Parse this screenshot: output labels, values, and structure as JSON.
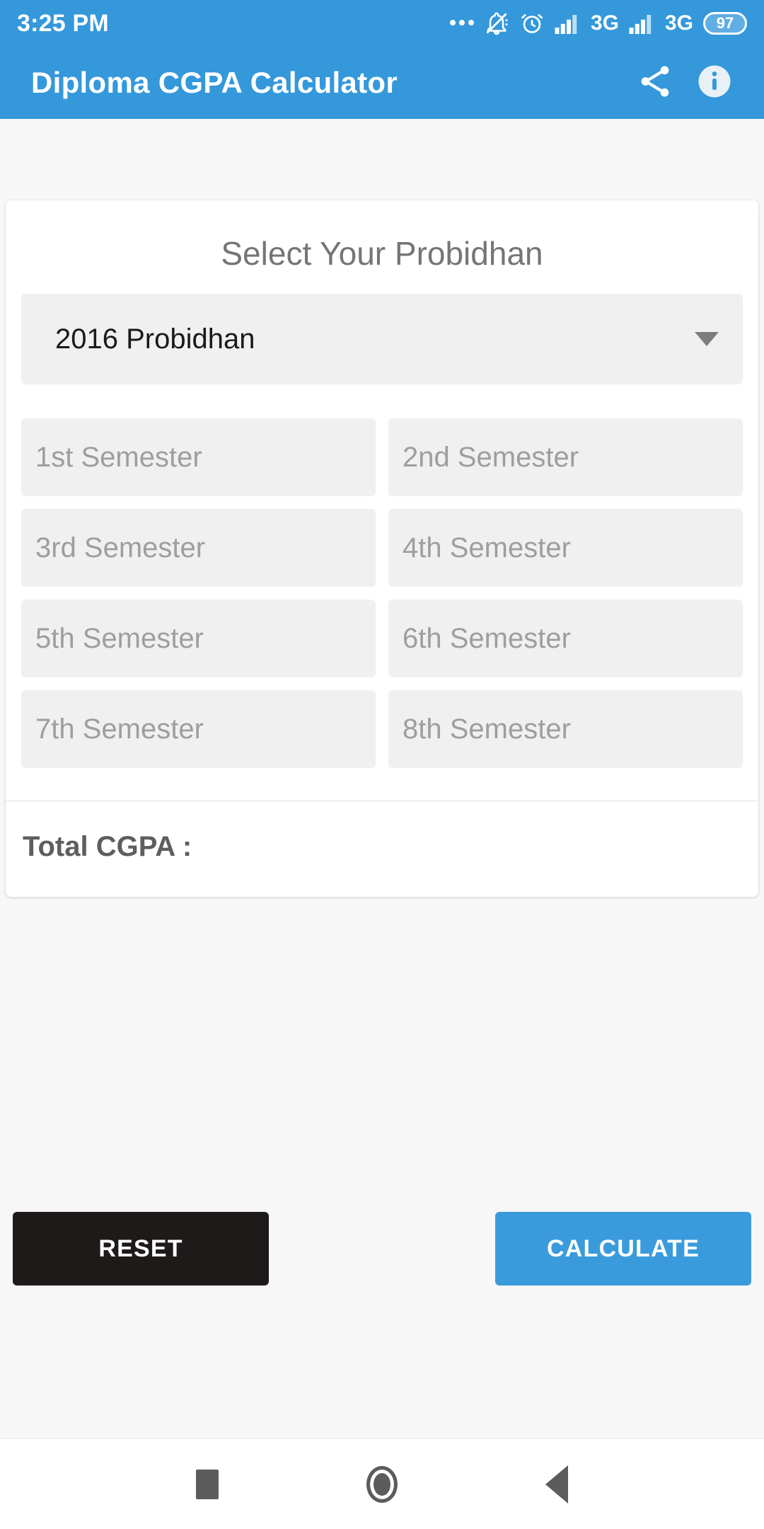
{
  "status_bar": {
    "time": "3:25 PM",
    "icons": [
      {
        "name": "more-notifications-icon",
        "label": "..."
      },
      {
        "name": "bell-muted-icon",
        "label": ""
      },
      {
        "name": "alarm-clock-icon",
        "label": ""
      },
      {
        "name": "signal-bars-icon",
        "label": ""
      },
      {
        "name": "network-type-1",
        "label": "3G"
      },
      {
        "name": "signal-bars-icon-2",
        "label": ""
      },
      {
        "name": "network-type-2",
        "label": "3G"
      }
    ],
    "battery_level": "97"
  },
  "app_bar": {
    "title": "Diploma CGPA Calculator",
    "share_icon": "share-icon",
    "info_icon": "info-icon"
  },
  "card": {
    "title": "Select Your Probidhan",
    "dropdown": {
      "selected": "2016 Probidhan",
      "caret_icon": "chevron-down-icon"
    },
    "semesters": [
      {
        "placeholder": "1st Semester",
        "value": ""
      },
      {
        "placeholder": "2nd Semester",
        "value": ""
      },
      {
        "placeholder": "3rd Semester",
        "value": ""
      },
      {
        "placeholder": "4th Semester",
        "value": ""
      },
      {
        "placeholder": "5th Semester",
        "value": ""
      },
      {
        "placeholder": "6th Semester",
        "value": ""
      },
      {
        "placeholder": "7th Semester",
        "value": ""
      },
      {
        "placeholder": "8th Semester",
        "value": ""
      }
    ],
    "total": {
      "label": "Total CGPA :",
      "value": ""
    }
  },
  "actions": {
    "reset_label": "RESET",
    "calculate_label": "CALCULATE"
  },
  "nav_bar": {
    "recents": "recents-square-icon",
    "home": "home-circle-icon",
    "back": "back-triangle-icon"
  },
  "colors": {
    "primary_blue": "#3498db",
    "calculate_blue": "#3a9bdc",
    "reset_black": "#1e1a1a",
    "field_gray": "#f0f0f0",
    "page_bg": "#f7f7f7"
  }
}
